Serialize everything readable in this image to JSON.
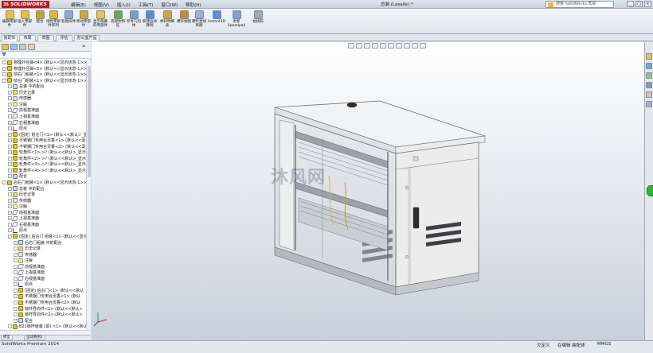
{
  "app": {
    "brand_prefix": "3S",
    "brand": "SOLIDWORKS"
  },
  "menus": [
    "编辑(E)",
    "视图(V)",
    "插入(I)",
    "工具(T)",
    "窗口(W)",
    "帮助(H)"
  ],
  "doc_title": "总装 (Lasalle) *",
  "search": {
    "placeholder": "搜索 SolidWorks 帮助"
  },
  "window_buttons": [
    "_",
    "□",
    "×"
  ],
  "ribbon": [
    {
      "label": "编辑零部件",
      "icon": "edit-component-icon",
      "color": "#f0c02c"
    },
    {
      "label": "插入零部件",
      "icon": "insert-component-icon",
      "color": "#f0c02c"
    },
    {
      "label": "配合",
      "icon": "mate-icon",
      "color": "#c9a227"
    },
    {
      "label": "线性零部件阵列",
      "icon": "linear-pattern-icon",
      "color": "#e5b82a"
    },
    {
      "label": "智能扣件",
      "icon": "smart-fastener-icon",
      "color": "#8ca8cc"
    },
    {
      "label": "移动零部件",
      "icon": "move-component-icon",
      "color": "#d9a62a"
    },
    {
      "label": "显示隐藏的零部件",
      "icon": "show-hidden-icon",
      "color": "#e8c34a"
    },
    {
      "label": "装配体特征",
      "icon": "assembly-feature-icon",
      "color": "#6aa84f"
    },
    {
      "label": "参考几何体",
      "icon": "reference-geometry-icon",
      "color": "#7a9ed1"
    },
    {
      "label": "新建运动算例",
      "icon": "motion-study-icon",
      "color": "#4f8fcf"
    },
    {
      "label": "材料明细表",
      "icon": "bom-icon",
      "color": "#d4a43a"
    },
    {
      "label": "爆炸视图",
      "icon": "exploded-view-icon",
      "color": "#c98a30"
    },
    {
      "label": "爆炸直线草图",
      "icon": "explode-line-icon",
      "color": "#9ab3d3"
    },
    {
      "label": "Instant3D",
      "icon": "instant3d-icon",
      "color": "#5a8fd6"
    },
    {
      "label": "更新Speedpak",
      "icon": "speedpak-icon",
      "color": "#7ea2c8"
    },
    {
      "label": "拍快照",
      "icon": "snapshot-icon",
      "color": "#9aa9bb"
    }
  ],
  "tabs": [
    "装配体",
    "布局",
    "草图",
    "评估",
    "办公室产品"
  ],
  "tree": [
    {
      "label": "物理外径漏<4> (默认<<显示状态-1>>)",
      "icon": "asm",
      "indent": 0
    },
    {
      "label": "物理外径漏<5> (默认<<显示状态-1>>)",
      "icon": "asm",
      "indent": 0
    },
    {
      "label": "前右门组装<1> (默认<<显示状态-1>>)",
      "icon": "asm",
      "indent": 0
    },
    {
      "label": "前左门组装<1> (默认<<显示状态-1>>)",
      "icon": "asm",
      "indent": 0
    },
    {
      "label": "总装 中的配合",
      "icon": "mate",
      "indent": 1
    },
    {
      "label": "历史记录",
      "icon": "fold",
      "indent": 1
    },
    {
      "label": "传感器",
      "icon": "sensor",
      "indent": 1
    },
    {
      "label": "注解",
      "icon": "note",
      "indent": 1
    },
    {
      "label": "前视基准面",
      "icon": "plane",
      "indent": 1
    },
    {
      "label": "上视基准面",
      "icon": "plane",
      "indent": 1
    },
    {
      "label": "右视基准面",
      "icon": "plane",
      "indent": 1
    },
    {
      "label": "原点",
      "icon": "origin",
      "indent": 1
    },
    {
      "label": "(固定) 前左门<1> (默认<<默认>_显示",
      "icon": "asm",
      "indent": 1
    },
    {
      "label": "不锈钢门专用合页香<1> (默认<<毫",
      "icon": "asm",
      "indent": 1
    },
    {
      "label": "不锈钢门专用合页香<2> (默认<<毫",
      "icon": "asm",
      "indent": 1
    },
    {
      "label": "轮角件<1>->? (默认<<默认>_显示",
      "icon": "asm",
      "indent": 1
    },
    {
      "label": "轮角件<2>->? (默认<<默认>_显示",
      "icon": "asm",
      "indent": 1
    },
    {
      "label": "轮角件<3>->? (默认<<默认>_显示",
      "icon": "asm",
      "indent": 1
    },
    {
      "label": "轮角件<4>->? (默认<<默认>_显示",
      "icon": "asm",
      "indent": 1
    },
    {
      "label": "配合",
      "icon": "mate",
      "indent": 1
    },
    {
      "label": "后右门组装<1> (默认<<显示状态-1>>)",
      "icon": "asm",
      "indent": 0
    },
    {
      "label": "总装 中的配合",
      "icon": "mate",
      "indent": 1
    },
    {
      "label": "历史记录",
      "icon": "fold",
      "indent": 1
    },
    {
      "label": "传感器",
      "icon": "sensor",
      "indent": 1
    },
    {
      "label": "注解",
      "icon": "note",
      "indent": 1
    },
    {
      "label": "前视基准面",
      "icon": "plane",
      "indent": 1
    },
    {
      "label": "上视基准面",
      "icon": "plane",
      "indent": 1
    },
    {
      "label": "右视基准面",
      "icon": "plane",
      "indent": 1
    },
    {
      "label": "原点",
      "icon": "origin",
      "indent": 1
    },
    {
      "label": "(固定) 后右门 组装<1> (默认<<显示状",
      "icon": "asm",
      "indent": 1
    },
    {
      "label": "后右门组装 中的配合",
      "icon": "mate",
      "indent": 2
    },
    {
      "label": "历史记录",
      "icon": "fold",
      "indent": 2
    },
    {
      "label": "传感器",
      "icon": "sensor",
      "indent": 2
    },
    {
      "label": "注解",
      "icon": "note",
      "indent": 2
    },
    {
      "label": "前视基准面",
      "icon": "plane",
      "indent": 2
    },
    {
      "label": "上视基准面",
      "icon": "plane",
      "indent": 2
    },
    {
      "label": "右视基准面",
      "icon": "plane",
      "indent": 2
    },
    {
      "label": "原点",
      "icon": "origin",
      "indent": 2
    },
    {
      "label": "(固定) 后右门<1> (默认<<默认",
      "icon": "asm",
      "indent": 2
    },
    {
      "label": "不锈钢门专用合页香<1> (默认",
      "icon": "asm",
      "indent": 2
    },
    {
      "label": "不锈钢门专用合页香<2> (默认",
      "icon": "asm",
      "indent": 2
    },
    {
      "label": "锁杆导向件<1> (默认<<默认>",
      "icon": "asm",
      "indent": 2
    },
    {
      "label": "锁杆导向件<2> (默认<<默认>",
      "icon": "asm",
      "indent": 2
    },
    {
      "label": "配合",
      "icon": "mate",
      "indent": 2
    },
    {
      "label": "B21锁杆组装 (前) <1> (默认<<默认>",
      "icon": "asm",
      "indent": 1
    }
  ],
  "bottom_tabs": [
    "模型",
    "运动算例1"
  ],
  "watermark": "沐风网",
  "status": {
    "product": "SolidWorks Premium 2014",
    "state1": "欠定义",
    "state2": "在编辑 装配体",
    "units": "MMGS"
  }
}
